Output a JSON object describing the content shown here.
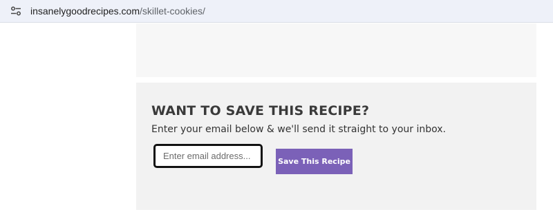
{
  "browser": {
    "site_settings_icon": "tune-icon",
    "url_domain": "insanelygoodrecipes.com",
    "url_path": "/skillet-cookies/"
  },
  "save_recipe": {
    "title": "WANT TO SAVE THIS RECIPE?",
    "subtitle": "Enter your email below & we'll send it straight to your inbox.",
    "email_placeholder": "Enter email address...",
    "email_value": "",
    "button_label": "Save This Recipe",
    "accent_color": "#7b61b8"
  }
}
